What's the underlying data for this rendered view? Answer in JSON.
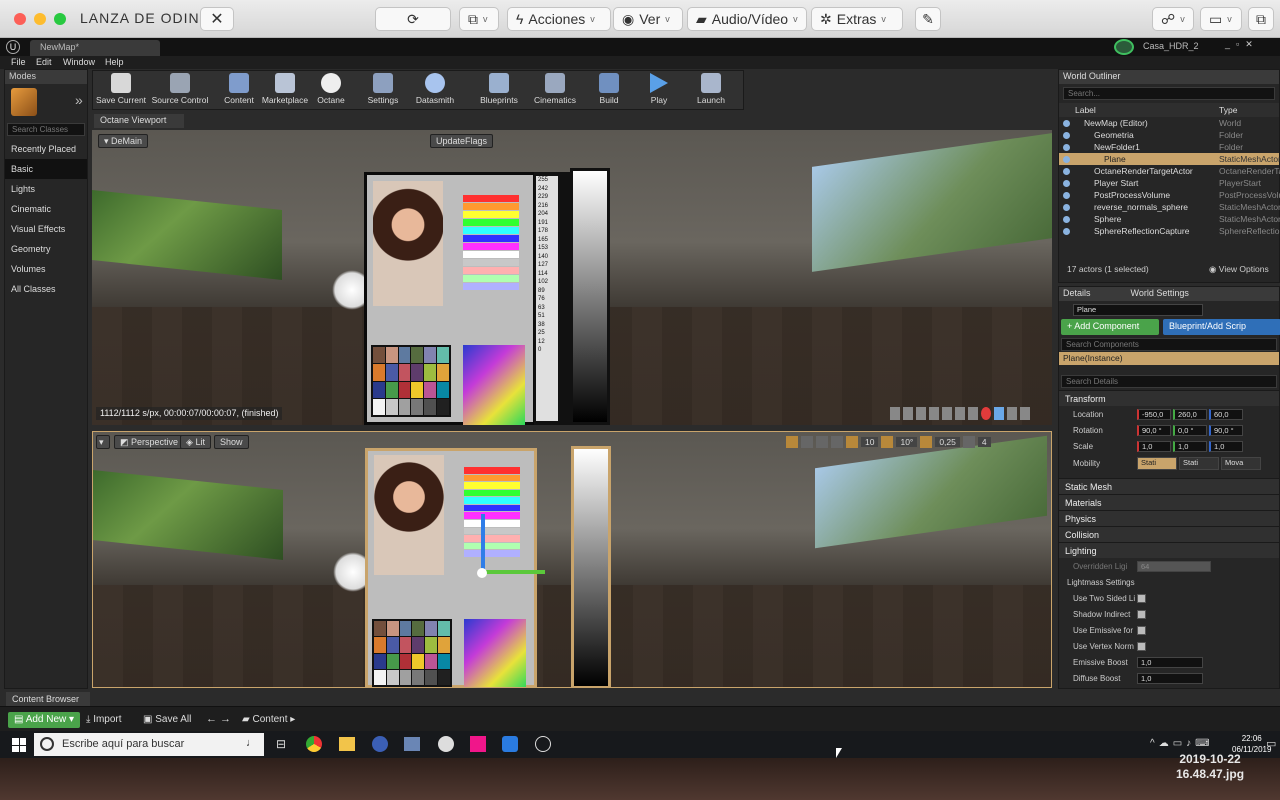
{
  "mac": {
    "title": "LANZA DE ODIN",
    "menu": [
      "Acciones",
      "Ver",
      "Audio/Vídeo",
      "Extras"
    ]
  },
  "ue": {
    "tab": "NewMap*",
    "project": "Casa_HDR_2",
    "menu": [
      "File",
      "Edit",
      "Window",
      "Help"
    ]
  },
  "modes": {
    "title": "Modes",
    "search_placeholder": "Search Classes",
    "items": [
      "Recently Placed",
      "Basic",
      "Lights",
      "Cinematic",
      "Visual Effects",
      "Geometry",
      "Volumes",
      "All Classes"
    ]
  },
  "toolbar": [
    "Save Current",
    "Source Control",
    "Content",
    "Marketplace",
    "Octane",
    "Settings",
    "Datasmith",
    "Blueprints",
    "Cinematics",
    "Build",
    "Play",
    "Launch"
  ],
  "octane_viewport": {
    "tab": "Octane Viewport",
    "demain": "DeMain",
    "update": "UpdateFlags",
    "status": "1112/1112 s/px, 00:00:07/00:00:07, (finished)"
  },
  "level_viewport": {
    "perspective": "Perspective",
    "lit": "Lit",
    "show": "Show",
    "grid": "10",
    "angle": "10°",
    "scale": "0,25",
    "cam": "4"
  },
  "chart_numbers": [
    "255",
    "242",
    "229",
    "216",
    "204",
    "191",
    "178",
    "165",
    "153",
    "140",
    "127",
    "114",
    "102",
    "89",
    "76",
    "63",
    "51",
    "38",
    "25",
    "12",
    "0"
  ],
  "outliner": {
    "title": "World Outliner",
    "search_placeholder": "Search...",
    "col_label": "Label",
    "col_type": "Type",
    "rows": [
      {
        "label": "NewMap (Editor)",
        "type": "World",
        "indent": 0
      },
      {
        "label": "Geometria",
        "type": "Folder",
        "indent": 1
      },
      {
        "label": "NewFolder1",
        "type": "Folder",
        "indent": 1
      },
      {
        "label": "Plane",
        "type": "StaticMeshActor",
        "indent": 2,
        "selected": true
      },
      {
        "label": "OctaneRenderTargetActor",
        "type": "OctaneRenderTar",
        "indent": 1
      },
      {
        "label": "Player Start",
        "type": "PlayerStart",
        "indent": 1
      },
      {
        "label": "PostProcessVolume",
        "type": "PostProcessVolu",
        "indent": 1
      },
      {
        "label": "reverse_normals_sphere",
        "type": "StaticMeshActor",
        "indent": 1
      },
      {
        "label": "Sphere",
        "type": "StaticMeshActor",
        "indent": 1
      },
      {
        "label": "SphereReflectionCapture",
        "type": "SphereReflection",
        "indent": 1
      }
    ],
    "count": "17 actors (1 selected)",
    "view_options": "View Options"
  },
  "details": {
    "tab": "Details",
    "tab2": "World Settings",
    "name": "Plane",
    "add_component": "+ Add Component",
    "blueprint": "Blueprint/Add Scrip",
    "search_components": "Search Components",
    "instance": "Plane(Instance)",
    "search_details": "Search Details",
    "transform": "Transform",
    "location_label": "Location",
    "location": [
      "-950,0",
      "260,0",
      "60,0"
    ],
    "rotation_label": "Rotation",
    "rotation": [
      "90,0 °",
      "0,0 °",
      "90,0 °"
    ],
    "scale_label": "Scale",
    "scale": [
      "1,0",
      "1,0",
      "1,0"
    ],
    "mobility_label": "Mobility",
    "mobility": [
      "Stati",
      "Stati",
      "Mova"
    ],
    "sections": [
      "Static Mesh",
      "Materials",
      "Physics",
      "Collision"
    ],
    "lighting": "Lighting",
    "overridden": "Overridden Ligi",
    "overridden_val": "64",
    "lightmass": "Lightmass Settings",
    "lm_props": [
      "Use Two Sided Li",
      "Shadow Indirect",
      "Use Emissive for",
      "Use Vertex Norm"
    ],
    "emissive_boost": "Emissive Boost",
    "emissive_val": "1,0",
    "diffuse_boost": "Diffuse Boost",
    "diffuse_val": "1,0"
  },
  "content_browser": {
    "tab": "Content Browser",
    "add_new": "Add New",
    "import": "Import",
    "save_all": "Save All",
    "path": "Content"
  },
  "taskbar": {
    "search": "Escribe aquí para buscar",
    "time": "22:06",
    "date": "06/11/2019"
  },
  "filename": [
    "2019-10-22",
    "16.48.47.jpg"
  ]
}
